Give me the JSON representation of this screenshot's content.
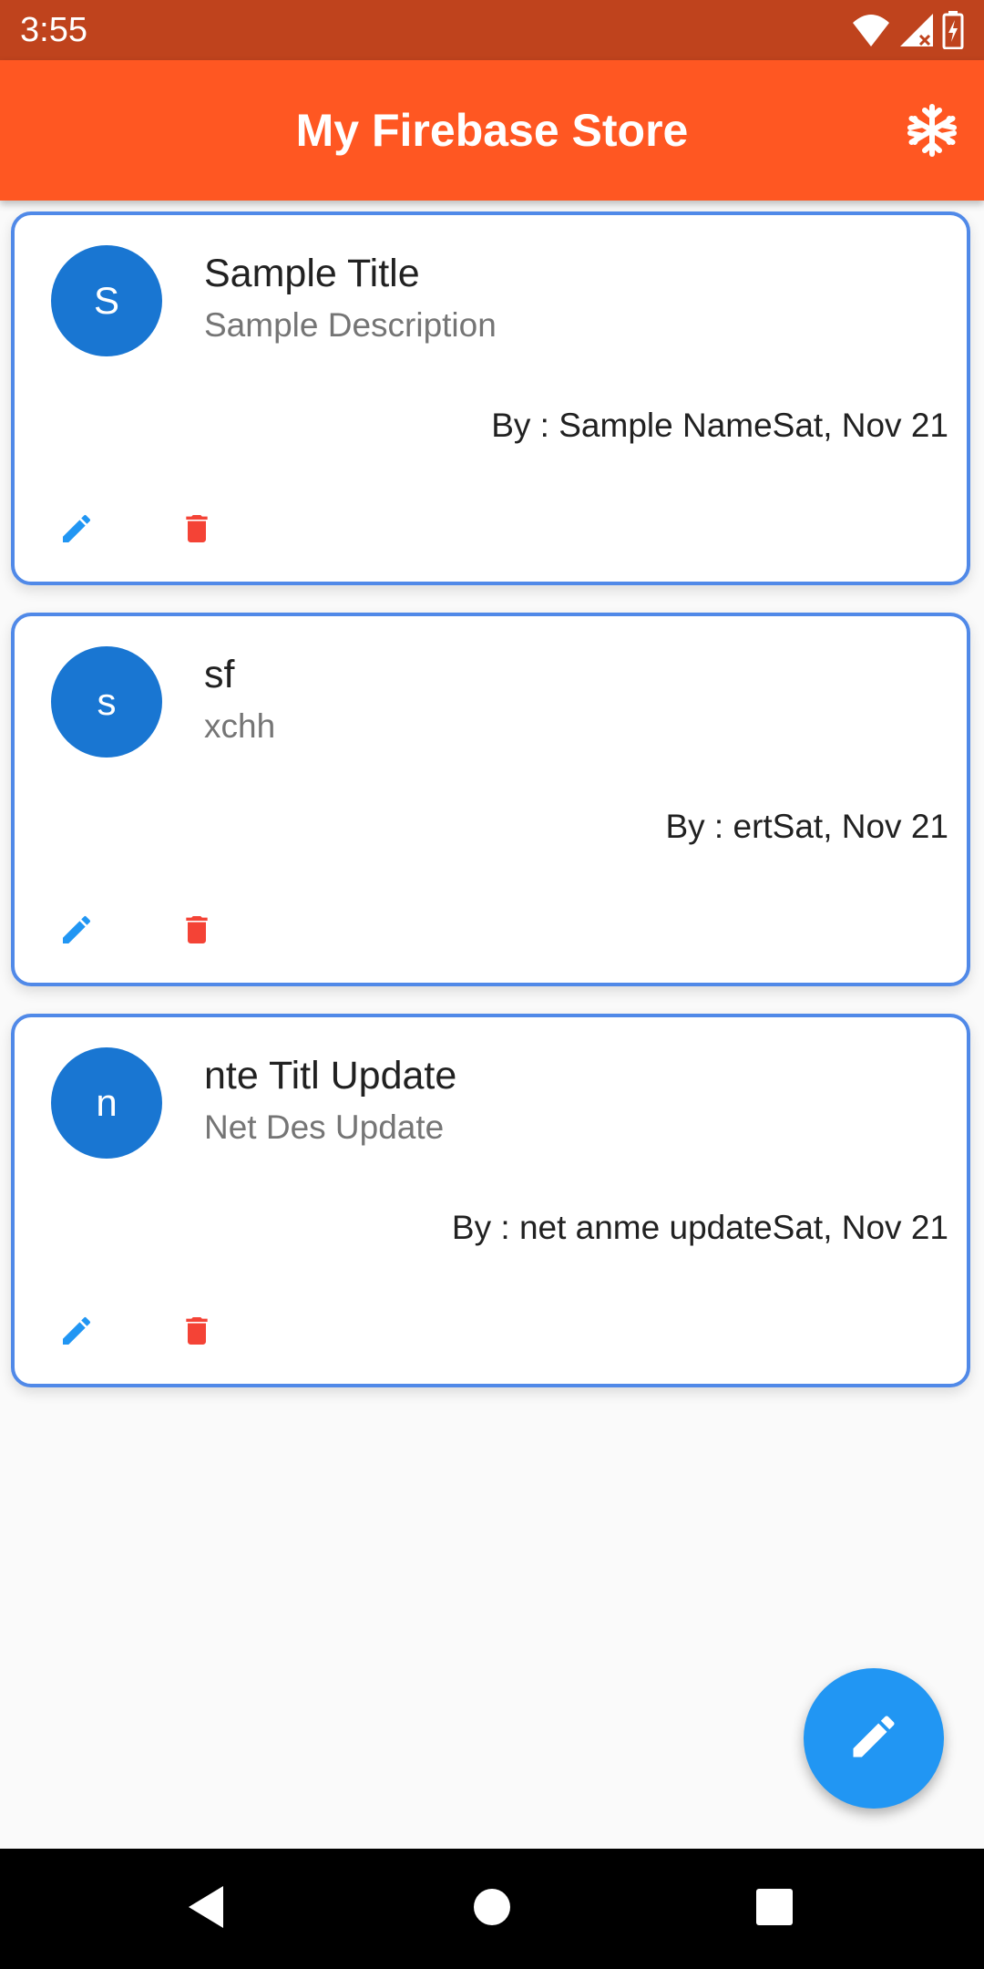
{
  "status_bar": {
    "time": "3:55",
    "icons": [
      "wifi-icon",
      "cellular-signal-icon",
      "battery-charging-icon"
    ]
  },
  "app_bar": {
    "title": "My Firebase Store",
    "action_icon": "snowflake-icon",
    "color": "#ff5722"
  },
  "notes": [
    {
      "avatar_letter": "S",
      "title": "Sample Title",
      "description": "Sample Description",
      "meta": "By : Sample NameSat, Nov 21"
    },
    {
      "avatar_letter": "s",
      "title": "sf",
      "description": "xchh",
      "meta": "By : ertSat, Nov 21"
    },
    {
      "avatar_letter": "n",
      "title": "nte Titl Update",
      "description": "Net Des Update",
      "meta": "By : net anme updateSat, Nov 21"
    }
  ],
  "colors": {
    "card_border": "#5089e8",
    "avatar": "#1976d2",
    "edit_icon": "#2196f3",
    "delete_icon": "#f44336",
    "fab": "#2196f3"
  },
  "fab": {
    "icon": "pencil-icon"
  },
  "nav_bar": {
    "icons": [
      "back-icon",
      "home-icon",
      "recents-icon"
    ]
  }
}
